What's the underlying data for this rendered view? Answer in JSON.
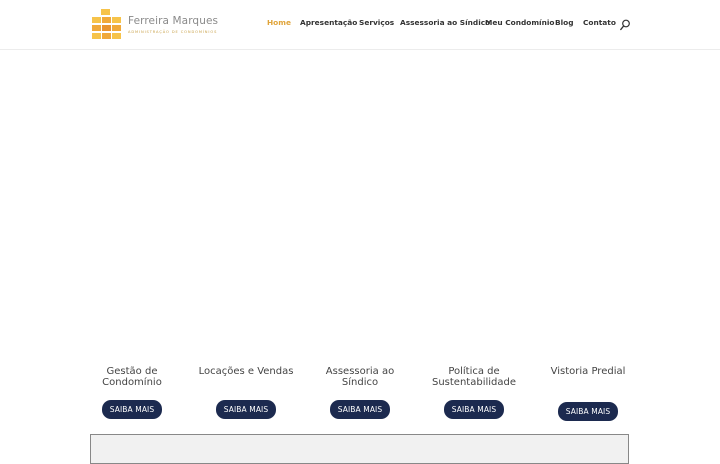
{
  "brand": {
    "name": "Ferreira Marques",
    "tagline": "ADMINISTRAÇÃO DE CONDOMÍNIOS",
    "accent": "#e0a43a",
    "logo_colors": [
      "#f6c34a",
      "#f0a93a",
      "#e9942f"
    ]
  },
  "nav": {
    "items": [
      {
        "label": "Home",
        "active": true
      },
      {
        "label": "Apresentação",
        "active": false
      },
      {
        "label": "Serviços",
        "active": false
      },
      {
        "label": "Assessoria ao Síndico",
        "active": false
      },
      {
        "label": "Meu Condomínio",
        "active": false
      },
      {
        "label": "Blog",
        "active": false
      },
      {
        "label": "Contato",
        "active": false
      }
    ],
    "search_icon": "search-icon"
  },
  "services": [
    {
      "title": "Gestão de Condomínio",
      "button": "SAIBA MAIS"
    },
    {
      "title": "Locações e Vendas",
      "button": "SAIBA MAIS"
    },
    {
      "title": "Assessoria ao Síndico",
      "button": "SAIBA MAIS"
    },
    {
      "title": "Política de Sustentabilidade",
      "button": "SAIBA MAIS"
    },
    {
      "title": "Vistoria Predial",
      "button": "SAIBA MAIS"
    }
  ],
  "colors": {
    "button_bg": "#1c2a4f",
    "nav_text": "#333333"
  }
}
